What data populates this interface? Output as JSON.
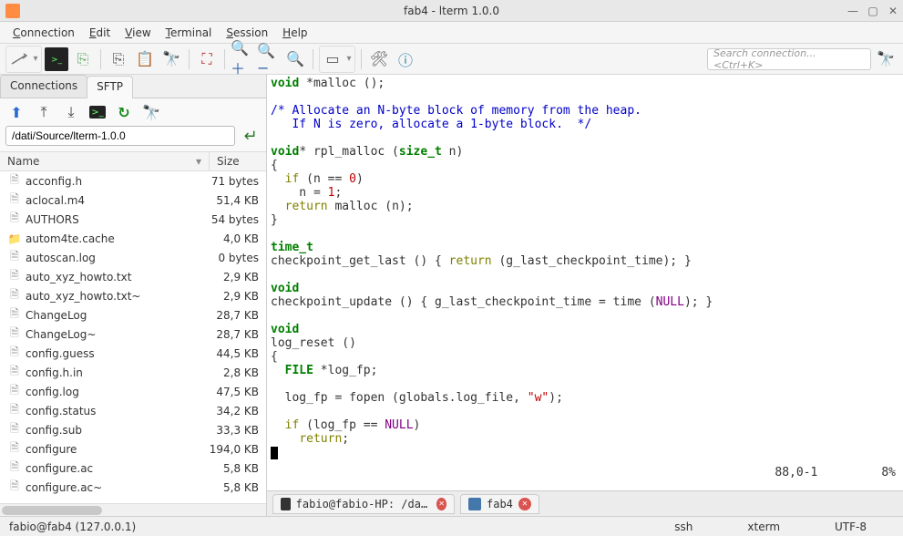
{
  "window": {
    "title": "fab4 - lterm 1.0.0"
  },
  "menu": {
    "connection": "Connection",
    "edit": "Edit",
    "view": "View",
    "terminal": "Terminal",
    "session": "Session",
    "help": "Help"
  },
  "toolbar": {
    "search_placeholder": "Search connection... <Ctrl+K>"
  },
  "side": {
    "tab_connections": "Connections",
    "tab_sftp": "SFTP",
    "path": "/dati/Source/lterm-1.0.0",
    "col_name": "Name",
    "col_size": "Size",
    "files": [
      {
        "name": "acconfig.h",
        "size": "71 bytes",
        "type": "file"
      },
      {
        "name": "aclocal.m4",
        "size": "51,4 KB",
        "type": "file"
      },
      {
        "name": "AUTHORS",
        "size": "54 bytes",
        "type": "file"
      },
      {
        "name": "autom4te.cache",
        "size": "4,0 KB",
        "type": "folder"
      },
      {
        "name": "autoscan.log",
        "size": "0 bytes",
        "type": "file"
      },
      {
        "name": "auto_xyz_howto.txt",
        "size": "2,9 KB",
        "type": "file"
      },
      {
        "name": "auto_xyz_howto.txt~",
        "size": "2,9 KB",
        "type": "file"
      },
      {
        "name": "ChangeLog",
        "size": "28,7 KB",
        "type": "file"
      },
      {
        "name": "ChangeLog~",
        "size": "28,7 KB",
        "type": "file"
      },
      {
        "name": "config.guess",
        "size": "44,5 KB",
        "type": "file"
      },
      {
        "name": "config.h.in",
        "size": "2,8 KB",
        "type": "file"
      },
      {
        "name": "config.log",
        "size": "47,5 KB",
        "type": "file"
      },
      {
        "name": "config.status",
        "size": "34,2 KB",
        "type": "file"
      },
      {
        "name": "config.sub",
        "size": "33,3 KB",
        "type": "file"
      },
      {
        "name": "configure",
        "size": "194,0 KB",
        "type": "file"
      },
      {
        "name": "configure.ac",
        "size": "5,8 KB",
        "type": "file"
      },
      {
        "name": "configure.ac~",
        "size": "5,8 KB",
        "type": "file"
      }
    ]
  },
  "editor": {
    "pos": "88,0-1",
    "pct": "8%"
  },
  "termtabs": {
    "t1": "fabio@fabio-HP: /dati/Sou …",
    "t2": "fab4"
  },
  "status": {
    "left": "fabio@fab4 (127.0.0.1)",
    "proto": "ssh",
    "term": "xterm",
    "enc": "UTF-8"
  }
}
